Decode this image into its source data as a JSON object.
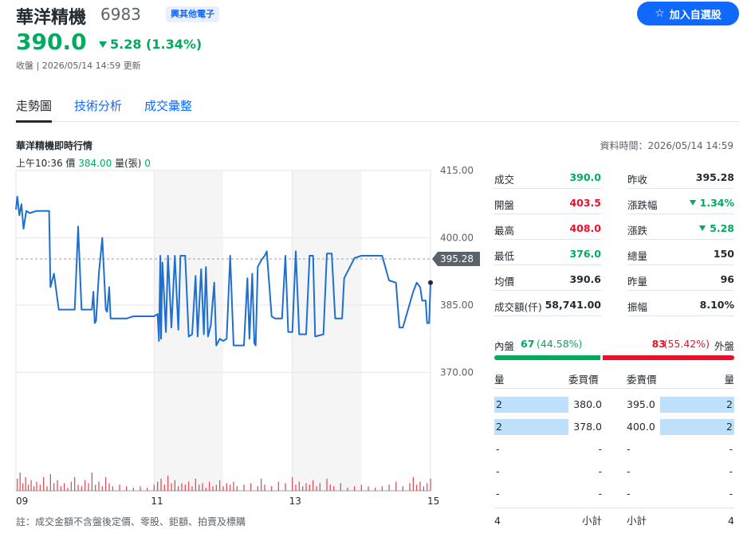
{
  "header": {
    "name": "華洋精機",
    "code": "6983",
    "industry": "興其他電子",
    "watch_label": "加入自選股",
    "price": "390.0",
    "change": "5.28 (1.34%)",
    "status": "收盤 | 2026/05/14 14:59 更新"
  },
  "tabs": [
    {
      "label": "走勢圖",
      "active": true
    },
    {
      "label": "技術分析",
      "active": false
    },
    {
      "label": "成交彙整",
      "active": false
    }
  ],
  "chart_header": {
    "title": "華洋精機即時行情",
    "data_time": "資料時間：2026/05/14 14:59",
    "hover_time": "上午10:36",
    "hover_price_label": "價",
    "hover_price": "384.00",
    "hover_volume_label": "量(張)",
    "hover_volume": "0"
  },
  "chart_data": {
    "type": "line",
    "x_tick_labels": [
      "09",
      "11",
      "13",
      "15"
    ],
    "y_tick_labels": [
      "415.00",
      "400.00",
      "385.00",
      "370.00"
    ],
    "ylim": [
      358,
      415
    ],
    "reference_price": 395.28,
    "reference_label": "395.28",
    "x_unit": "hours",
    "xlim": [
      9,
      15
    ],
    "grid": true,
    "price_series": [
      [
        9.0,
        406.3
      ],
      [
        9.02,
        409.2
      ],
      [
        9.05,
        405.0
      ],
      [
        9.08,
        407.5
      ],
      [
        9.11,
        402.0
      ],
      [
        9.15,
        406.0
      ],
      [
        9.2,
        405.5
      ],
      [
        9.3,
        406.0
      ],
      [
        9.48,
        406.0
      ],
      [
        9.5,
        389.0
      ],
      [
        9.55,
        392.0
      ],
      [
        9.62,
        384.0
      ],
      [
        9.85,
        384.0
      ],
      [
        9.88,
        395.0
      ],
      [
        9.9,
        402.5
      ],
      [
        9.95,
        384.0
      ],
      [
        10.05,
        384.0
      ],
      [
        10.1,
        384.0
      ],
      [
        10.12,
        388.0
      ],
      [
        10.14,
        381.0
      ],
      [
        10.16,
        381.5
      ],
      [
        10.2,
        392.0
      ],
      [
        10.25,
        400.0
      ],
      [
        10.3,
        384.0
      ],
      [
        10.32,
        383.5
      ],
      [
        10.35,
        389.0
      ],
      [
        10.37,
        382.0
      ],
      [
        10.6,
        382.0
      ],
      [
        10.7,
        382.5
      ],
      [
        11.0,
        382.5
      ],
      [
        11.05,
        383.0
      ],
      [
        11.07,
        377.0
      ],
      [
        11.09,
        396.0
      ],
      [
        11.1,
        377.5
      ],
      [
        11.12,
        394.5
      ],
      [
        11.17,
        379.0
      ],
      [
        11.2,
        396.0
      ],
      [
        11.25,
        380.0
      ],
      [
        11.3,
        396.0
      ],
      [
        11.35,
        379.5
      ],
      [
        11.38,
        396.0
      ],
      [
        11.45,
        396.0
      ],
      [
        11.5,
        378.0
      ],
      [
        11.55,
        378.5
      ],
      [
        11.6,
        391.5
      ],
      [
        11.63,
        378.0
      ],
      [
        11.68,
        393.0
      ],
      [
        11.72,
        378.5
      ],
      [
        11.75,
        393.5
      ],
      [
        11.78,
        378.0
      ],
      [
        11.82,
        380.5
      ],
      [
        11.87,
        390.0
      ],
      [
        11.9,
        376.0
      ],
      [
        11.95,
        377.5
      ],
      [
        12.0,
        377.0
      ],
      [
        12.05,
        377.5
      ],
      [
        12.1,
        396.0
      ],
      [
        12.15,
        376.0
      ],
      [
        12.3,
        376.0
      ],
      [
        12.35,
        391.0
      ],
      [
        12.38,
        377.5
      ],
      [
        12.42,
        392.0
      ],
      [
        12.45,
        376.5
      ],
      [
        12.47,
        376.0
      ],
      [
        12.5,
        393.5
      ],
      [
        12.55,
        395.0
      ],
      [
        12.6,
        396.0
      ],
      [
        12.63,
        397.0
      ],
      [
        12.7,
        382.5
      ],
      [
        12.75,
        382.0
      ],
      [
        12.85,
        382.0
      ],
      [
        12.9,
        396.0
      ],
      [
        12.94,
        379.0
      ],
      [
        13.0,
        379.0
      ],
      [
        13.05,
        397.0
      ],
      [
        13.1,
        378.5
      ],
      [
        13.2,
        378.5
      ],
      [
        13.25,
        396.0
      ],
      [
        13.3,
        396.0
      ],
      [
        13.33,
        378.0
      ],
      [
        13.45,
        378.5
      ],
      [
        13.5,
        396.5
      ],
      [
        13.57,
        396.5
      ],
      [
        13.62,
        382.0
      ],
      [
        13.72,
        382.0
      ],
      [
        13.75,
        391.0
      ],
      [
        13.9,
        395.5
      ],
      [
        14.0,
        396.0
      ],
      [
        14.3,
        396.0
      ],
      [
        14.4,
        390.5
      ],
      [
        14.5,
        390.0
      ],
      [
        14.55,
        380.0
      ],
      [
        14.6,
        380.0
      ],
      [
        14.75,
        388.0
      ],
      [
        14.8,
        390.0
      ],
      [
        14.85,
        389.0
      ],
      [
        14.88,
        386.0
      ],
      [
        14.93,
        386.0
      ],
      [
        14.95,
        381.0
      ],
      [
        14.98,
        381.0
      ],
      [
        15.0,
        390.0
      ]
    ],
    "volume_series": [
      [
        9.02,
        8
      ],
      [
        9.06,
        12
      ],
      [
        9.1,
        5
      ],
      [
        9.14,
        9
      ],
      [
        9.18,
        4
      ],
      [
        9.22,
        7
      ],
      [
        9.26,
        3
      ],
      [
        9.3,
        6
      ],
      [
        9.35,
        4
      ],
      [
        9.4,
        9
      ],
      [
        9.45,
        3
      ],
      [
        9.5,
        11
      ],
      [
        9.55,
        5
      ],
      [
        9.6,
        7
      ],
      [
        9.65,
        3
      ],
      [
        9.7,
        5
      ],
      [
        9.75,
        2
      ],
      [
        9.8,
        6
      ],
      [
        9.85,
        9
      ],
      [
        9.9,
        4
      ],
      [
        9.95,
        3
      ],
      [
        10.0,
        7
      ],
      [
        10.05,
        5
      ],
      [
        10.1,
        12
      ],
      [
        10.15,
        4
      ],
      [
        10.2,
        6
      ],
      [
        10.25,
        3
      ],
      [
        10.3,
        9
      ],
      [
        10.35,
        5
      ],
      [
        10.4,
        3
      ],
      [
        10.5,
        4
      ],
      [
        10.6,
        3
      ],
      [
        10.7,
        2
      ],
      [
        10.8,
        3
      ],
      [
        10.9,
        2
      ],
      [
        11.0,
        4
      ],
      [
        11.05,
        6
      ],
      [
        11.1,
        8
      ],
      [
        11.15,
        4
      ],
      [
        11.2,
        10
      ],
      [
        11.25,
        5
      ],
      [
        11.3,
        7
      ],
      [
        11.35,
        3
      ],
      [
        11.4,
        5
      ],
      [
        11.45,
        4
      ],
      [
        11.5,
        6
      ],
      [
        11.55,
        3
      ],
      [
        11.6,
        8
      ],
      [
        11.65,
        4
      ],
      [
        11.7,
        5
      ],
      [
        11.75,
        2
      ],
      [
        11.8,
        6
      ],
      [
        11.85,
        3
      ],
      [
        11.9,
        4
      ],
      [
        11.95,
        7
      ],
      [
        12.0,
        3
      ],
      [
        12.05,
        5
      ],
      [
        12.1,
        4
      ],
      [
        12.15,
        6
      ],
      [
        12.2,
        3
      ],
      [
        12.3,
        4
      ],
      [
        12.4,
        5
      ],
      [
        12.5,
        3
      ],
      [
        12.55,
        8
      ],
      [
        12.6,
        4
      ],
      [
        12.7,
        3
      ],
      [
        12.8,
        6
      ],
      [
        12.9,
        5
      ],
      [
        13.0,
        9
      ],
      [
        13.05,
        4
      ],
      [
        13.1,
        6
      ],
      [
        13.15,
        3
      ],
      [
        13.2,
        5
      ],
      [
        13.25,
        4
      ],
      [
        13.3,
        7
      ],
      [
        13.35,
        3
      ],
      [
        13.4,
        5
      ],
      [
        13.5,
        8
      ],
      [
        13.55,
        4
      ],
      [
        13.6,
        3
      ],
      [
        13.7,
        5
      ],
      [
        13.8,
        2
      ],
      [
        13.9,
        3
      ],
      [
        14.0,
        4
      ],
      [
        14.1,
        3
      ],
      [
        14.2,
        2
      ],
      [
        14.3,
        3
      ],
      [
        14.4,
        4
      ],
      [
        14.5,
        6
      ],
      [
        14.6,
        3
      ],
      [
        14.7,
        5
      ],
      [
        14.75,
        9
      ],
      [
        14.8,
        4
      ],
      [
        14.85,
        6
      ],
      [
        14.9,
        3
      ],
      [
        14.95,
        5
      ],
      [
        15.0,
        8
      ]
    ],
    "colors": {
      "line": "#1f6fd0",
      "volume": "#e0424f",
      "shade": "#f5f5f5"
    }
  },
  "stats": {
    "left": [
      {
        "label": "成交",
        "value": "390.0",
        "color": "green"
      },
      {
        "label": "開盤",
        "value": "403.5",
        "color": "red"
      },
      {
        "label": "最高",
        "value": "408.0",
        "color": "red"
      },
      {
        "label": "最低",
        "value": "376.0",
        "color": "green"
      },
      {
        "label": "均價",
        "value": "390.6",
        "color": "dark"
      },
      {
        "label": "成交額(仟)",
        "value": "58,741.00",
        "color": "dark"
      }
    ],
    "right": [
      {
        "label": "昨收",
        "value": "395.28",
        "color": "dark",
        "arrow": false
      },
      {
        "label": "漲跌幅",
        "value": "1.34%",
        "color": "green",
        "arrow": true
      },
      {
        "label": "漲跌",
        "value": "5.28",
        "color": "green",
        "arrow": true
      },
      {
        "label": "總量",
        "value": "150",
        "color": "dark",
        "arrow": false
      },
      {
        "label": "昨量",
        "value": "96",
        "color": "dark",
        "arrow": false
      },
      {
        "label": "振幅",
        "value": "8.10%",
        "color": "dark",
        "arrow": false
      }
    ]
  },
  "inner_outer": {
    "inner_label": "內盤",
    "inner_value": "67",
    "inner_pct": "(44.58%)",
    "inner_fraction": 0.4458,
    "outer_value": "83",
    "outer_pct": "(55.42%)",
    "outer_label": "外盤"
  },
  "order_book": {
    "bid_qty_header": "量",
    "bid_price_header": "委買價",
    "ask_price_header": "委賣價",
    "ask_qty_header": "量",
    "bids": [
      {
        "qty": "2",
        "price": "380.0"
      },
      {
        "qty": "2",
        "price": "378.0"
      },
      {
        "qty": "-",
        "price": "-"
      },
      {
        "qty": "-",
        "price": "-"
      },
      {
        "qty": "-",
        "price": "-"
      }
    ],
    "asks": [
      {
        "price": "395.0",
        "qty": "2"
      },
      {
        "price": "400.0",
        "qty": "2"
      },
      {
        "price": "-",
        "qty": "-"
      },
      {
        "price": "-",
        "qty": "-"
      },
      {
        "price": "-",
        "qty": "-"
      }
    ],
    "bid_total_qty": "4",
    "bid_total_label": "小計",
    "ask_total_label": "小計",
    "ask_total_qty": "4"
  },
  "footnote": "註：成交金額不含盤後定價、零股、鉅額、拍賣及標購"
}
